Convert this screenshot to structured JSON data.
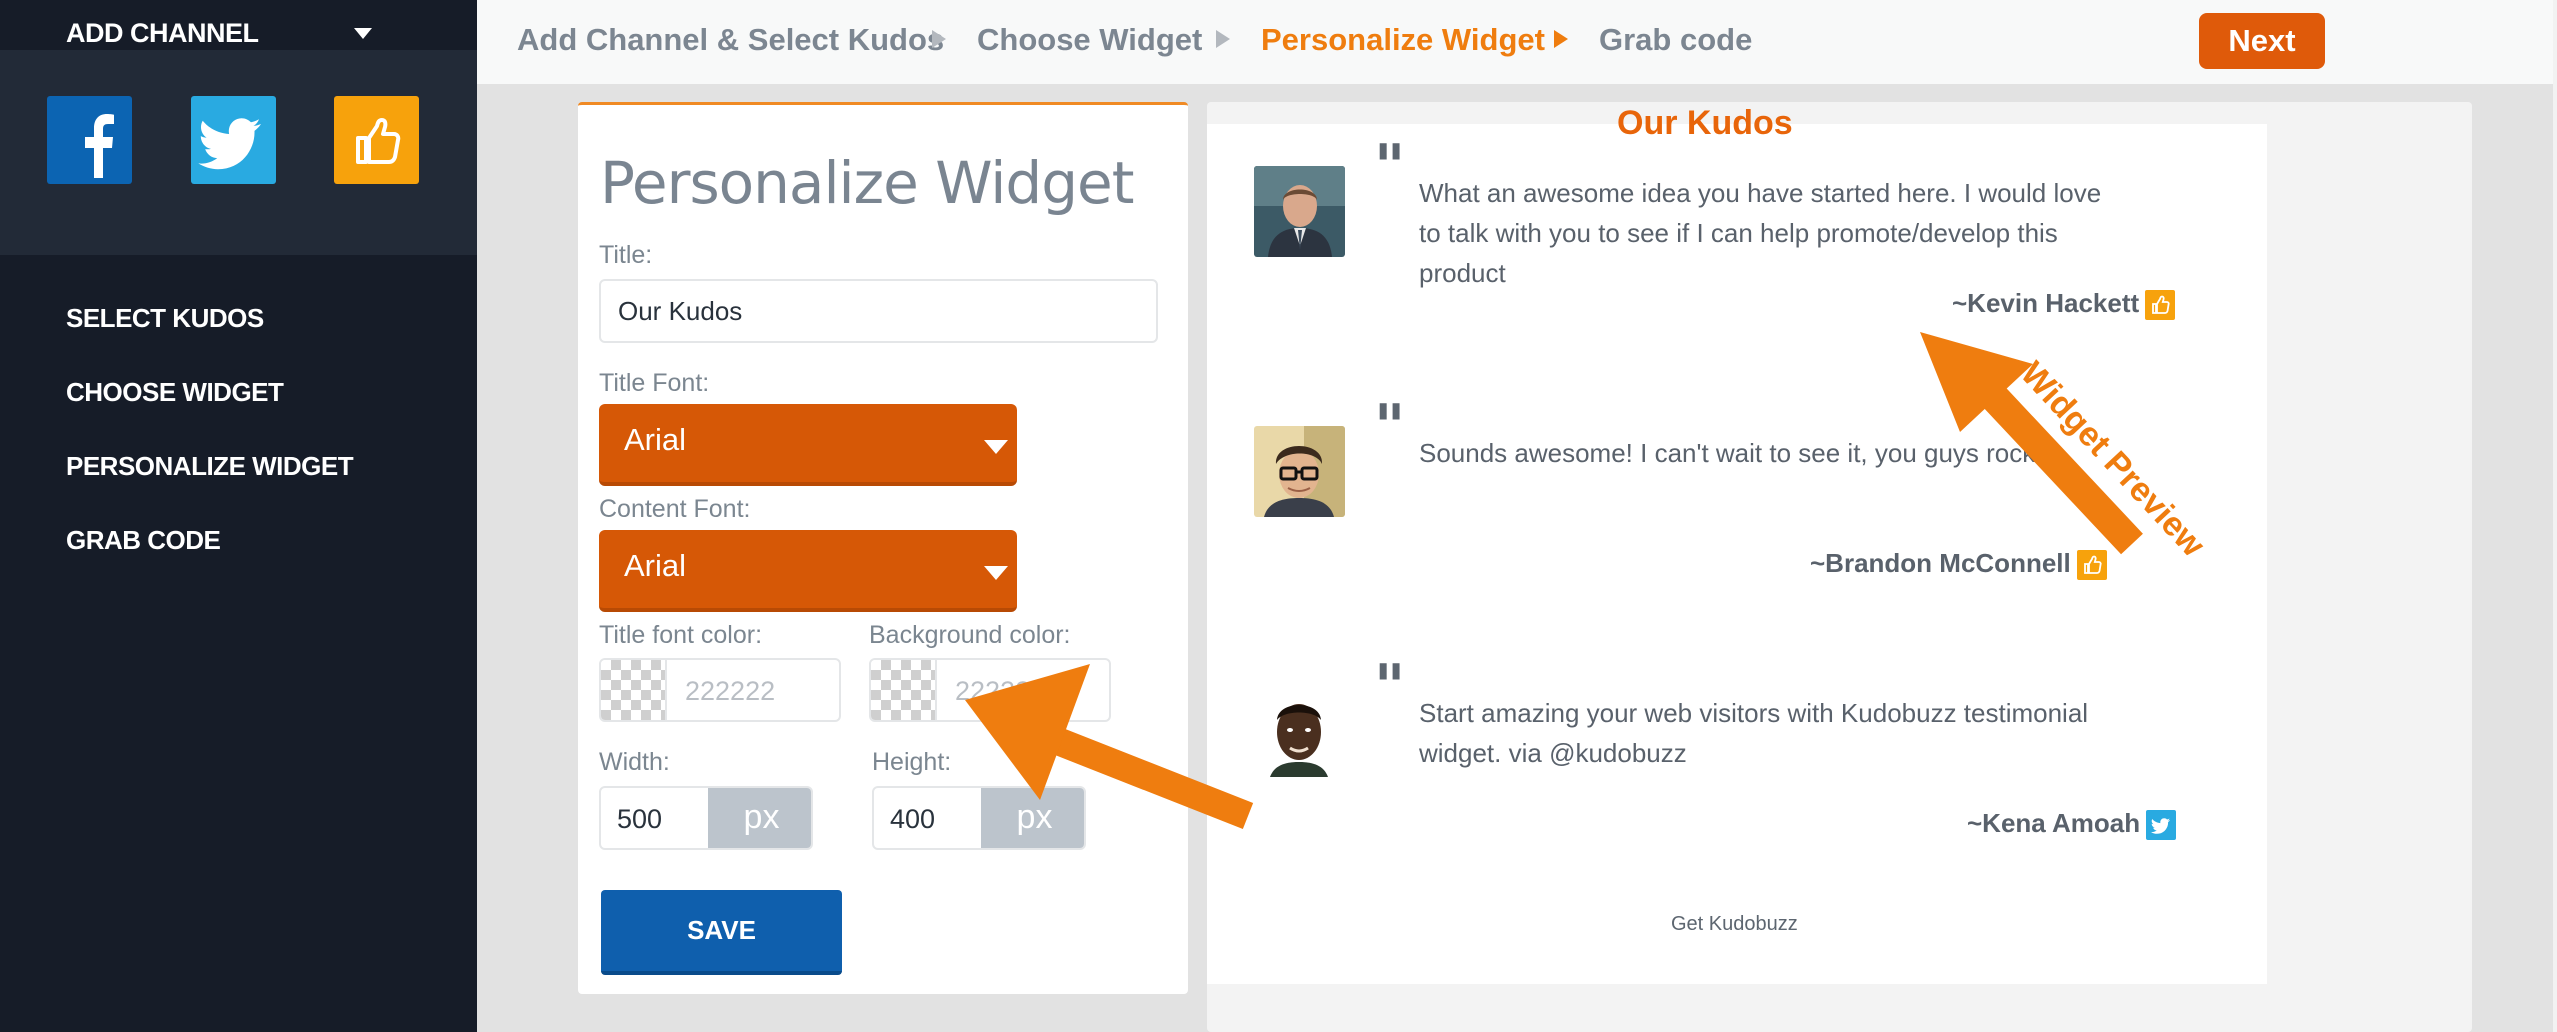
{
  "sidebar": {
    "add_channel_label": "ADD CHANNEL",
    "channels": [
      {
        "name": "facebook",
        "color": "#0c64b2"
      },
      {
        "name": "twitter",
        "color": "#29aae1"
      },
      {
        "name": "kudobuzz",
        "color": "#f7a20c"
      }
    ],
    "nav": [
      {
        "label": "SELECT KUDOS"
      },
      {
        "label": "CHOOSE WIDGET"
      },
      {
        "label": "PERSONALIZE WIDGET"
      },
      {
        "label": "GRAB CODE"
      }
    ]
  },
  "breadcrumb": {
    "steps": [
      {
        "label": "Add Channel & Select Kudos",
        "active": false
      },
      {
        "label": "Choose Widget",
        "active": false
      },
      {
        "label": "Personalize Widget",
        "active": true
      },
      {
        "label": "Grab code",
        "active": false
      }
    ],
    "next_label": "Next"
  },
  "form": {
    "heading": "Personalize Widget",
    "title_label": "Title:",
    "title_value": "Our Kudos",
    "title_font_label": "Title Font:",
    "title_font_value": "Arial",
    "content_font_label": "Content Font:",
    "content_font_value": "Arial",
    "title_color_label": "Title font color:",
    "title_color_value": "222222",
    "bg_color_label": "Background color:",
    "bg_color_value": "222222",
    "width_label": "Width:",
    "width_value": "500",
    "width_unit": "px",
    "height_label": "Height:",
    "height_value": "400",
    "height_unit": "px",
    "save_label": "SAVE"
  },
  "preview": {
    "title": "Our Kudos",
    "testimonials": [
      {
        "text": "What an awesome idea you have started here. I would love to talk with you to see if I can help promote/develop this product",
        "author": "~Kevin Hackett",
        "source": "kudobuzz"
      },
      {
        "text": "Sounds awesome! I can't wait to see it, you guys rock!",
        "author": "~Brandon McConnell",
        "source": "kudobuzz"
      },
      {
        "text": "Start amazing your web visitors with Kudobuzz testimonial widget. via @kudobuzz",
        "author": "~Kena Amoah",
        "source": "twitter"
      }
    ],
    "footer": "Get Kudobuzz"
  },
  "annotation": {
    "label": "Widget Preview",
    "color": "#ef7d0f"
  },
  "colors": {
    "accent": "#ef7d0f",
    "select_bg": "#d65806",
    "save_bg": "#0f5fad",
    "sidebar_bg": "#161c28"
  }
}
